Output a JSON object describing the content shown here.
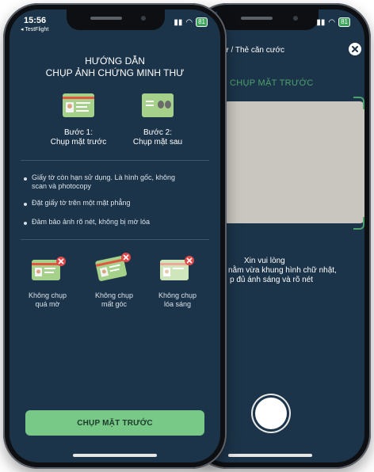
{
  "status_bar": {
    "time": "15:56",
    "back_app": "◂ TestFlight",
    "battery": "81"
  },
  "guide": {
    "title_line1": "HƯỚNG DẪN",
    "title_line2": "CHỤP ẢNH CHỨNG MINH THƯ",
    "steps": [
      {
        "line1": "Bước 1:",
        "line2": "Chụp mặt trước",
        "icon": "id-card-front-icon"
      },
      {
        "line1": "Bước 2:",
        "line2": "Chụp mặt sau",
        "icon": "id-card-back-icon"
      }
    ],
    "tips": [
      "Giấy tờ còn hạn sử dụng. Là hình gốc, không",
      "scan và photocopy",
      "Đặt giấy tờ trên một mặt phẳng",
      "Đảm bảo ảnh rõ nét, không bị mờ lóa"
    ],
    "donts": [
      {
        "line1": "Không chụp",
        "line2": "quá mờ"
      },
      {
        "line1": "Không chụp",
        "line2": "mất góc"
      },
      {
        "line1": "Không chụp",
        "line2": "lóa sáng"
      }
    ],
    "button_label": "CHỤP MẶT TRƯỚC"
  },
  "camera": {
    "breadcrumb": "ư / Thẻ căn cước",
    "section_title": "CHỤP MẶT TRƯỚC",
    "instruction_line1": "Xin vui lòng",
    "instruction_line2": "nằm vừa khung hình chữ nhật,",
    "instruction_line3": "p đủ ánh sáng và rõ nét",
    "close_icon": "close-icon",
    "shutter_icon": "shutter-button-icon"
  },
  "colors": {
    "screen_bg": "#1c3449",
    "accent_green": "#4ea16d",
    "button_green": "#78c888",
    "error_red": "#e04848"
  }
}
